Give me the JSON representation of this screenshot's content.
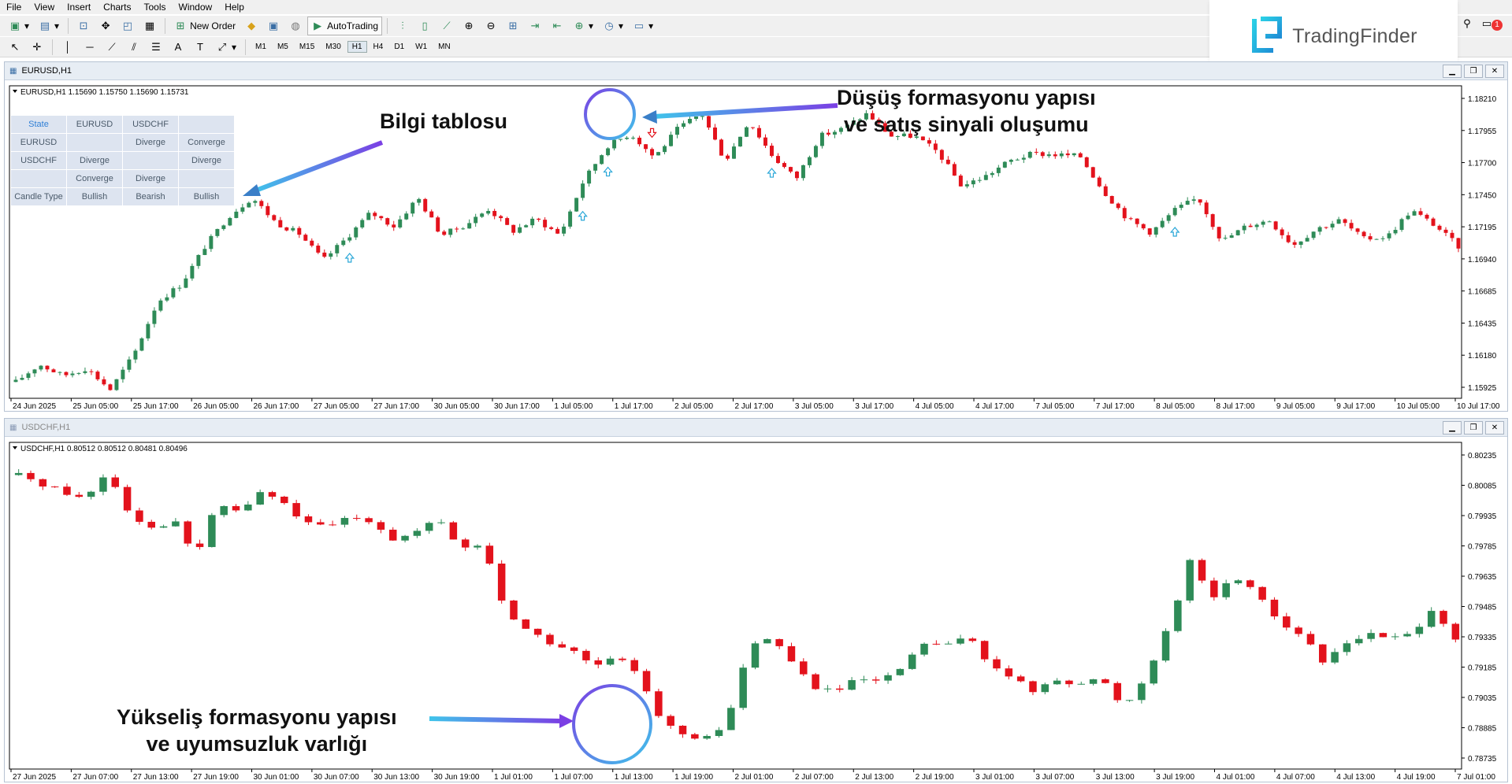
{
  "menu": [
    "File",
    "View",
    "Insert",
    "Charts",
    "Tools",
    "Window",
    "Help"
  ],
  "toolbar": {
    "new_order": "New Order",
    "autotrading": "AutoTrading"
  },
  "timeframes": [
    "M1",
    "M5",
    "M15",
    "M30",
    "H1",
    "H4",
    "D1",
    "W1",
    "MN"
  ],
  "active_timeframe": "H1",
  "brand": {
    "name": "TradingFinder"
  },
  "notifications": "1",
  "window1": {
    "title": "EURUSD,H1",
    "chart_data": {
      "type": "candlestick",
      "symbol": "EURUSD",
      "info": "EURUSD,H1  1.15690 1.15750 1.15690 1.15731",
      "y_ticks": [
        "1.18210",
        "1.17955",
        "1.17700",
        "1.17450",
        "1.17195",
        "1.16940",
        "1.16685",
        "1.16435",
        "1.16180",
        "1.15925"
      ],
      "x_ticks": [
        "24 Jun 2025",
        "25 Jun 05:00",
        "25 Jun 17:00",
        "26 Jun 05:00",
        "26 Jun 17:00",
        "27 Jun 05:00",
        "27 Jun 17:00",
        "30 Jun 05:00",
        "30 Jun 17:00",
        "1 Jul 05:00",
        "1 Jul 17:00",
        "2 Jul 05:00",
        "2 Jul 17:00",
        "3 Jul 05:00",
        "3 Jul 17:00",
        "4 Jul 05:00",
        "4 Jul 17:00",
        "7 Jul 05:00",
        "7 Jul 17:00",
        "8 Jul 05:00",
        "8 Jul 17:00",
        "9 Jul 05:00",
        "9 Jul 17:00",
        "10 Jul 05:00",
        "10 Jul 17:00"
      ],
      "ylim": [
        1.1585,
        1.1834
      ],
      "path": [
        1.1598,
        1.1612,
        1.1603,
        1.1609,
        1.1592,
        1.162,
        1.1662,
        1.1676,
        1.1706,
        1.173,
        1.1745,
        1.1725,
        1.1716,
        1.1695,
        1.1713,
        1.1733,
        1.1722,
        1.1745,
        1.1715,
        1.1723,
        1.1736,
        1.1718,
        1.1728,
        1.1715,
        1.1758,
        1.1786,
        1.1796,
        1.1777,
        1.18,
        1.1812,
        1.1774,
        1.1806,
        1.1778,
        1.176,
        1.1794,
        1.18,
        1.1812,
        1.1794,
        1.1794,
        1.1781,
        1.1754,
        1.1762,
        1.1774,
        1.178,
        1.1779,
        1.1778,
        1.175,
        1.1728,
        1.1717,
        1.1735,
        1.1745,
        1.171,
        1.1722,
        1.1727,
        1.1707,
        1.172,
        1.1727,
        1.1712,
        1.1714,
        1.1735,
        1.1723,
        1.1706
      ],
      "signals": [
        {
          "dir": "up",
          "index": 14
        },
        {
          "dir": "up",
          "index": 24
        },
        {
          "dir": "up",
          "index": 25
        },
        {
          "dir": "down",
          "index": 27
        },
        {
          "dir": "up",
          "index": 32
        },
        {
          "dir": "up",
          "index": 49
        }
      ]
    },
    "info_table": {
      "rows": [
        [
          "State",
          "EURUSD",
          "USDCHF",
          ""
        ],
        [
          "EURUSD",
          "",
          "Diverge",
          "Converge"
        ],
        [
          "USDCHF",
          "Diverge",
          "",
          "Diverge"
        ],
        [
          "",
          "Converge",
          "Diverge",
          ""
        ],
        [
          "Candle Type",
          "Bullish",
          "Bearish",
          "Bullish"
        ]
      ]
    }
  },
  "window2": {
    "title": "USDCHF,H1",
    "chart_data": {
      "type": "candlestick",
      "symbol": "USDCHF",
      "info": "USDCHF,H1  0.80512 0.80512 0.80481 0.80496",
      "y_ticks": [
        "0.80235",
        "0.80085",
        "0.79935",
        "0.79785",
        "0.79635",
        "0.79485",
        "0.79335",
        "0.79185",
        "0.79035",
        "0.78885",
        "0.78735"
      ],
      "x_ticks": [
        "27 Jun 2025",
        "27 Jun 07:00",
        "27 Jun 13:00",
        "27 Jun 19:00",
        "30 Jun 01:00",
        "30 Jun 07:00",
        "30 Jun 13:00",
        "30 Jun 19:00",
        "1 Jul 01:00",
        "1 Jul 07:00",
        "1 Jul 13:00",
        "1 Jul 19:00",
        "2 Jul 01:00",
        "2 Jul 07:00",
        "2 Jul 13:00",
        "2 Jul 19:00",
        "3 Jul 01:00",
        "3 Jul 07:00",
        "3 Jul 13:00",
        "3 Jul 19:00",
        "4 Jul 01:00",
        "4 Jul 07:00",
        "4 Jul 13:00",
        "4 Jul 19:00",
        "7 Jul 01:00"
      ],
      "ylim": [
        0.7868,
        0.8028
      ],
      "path": [
        0.8012,
        0.8008,
        0.8004,
        0.8,
        0.8014,
        0.7994,
        0.7986,
        0.799,
        0.7972,
        0.7998,
        0.7994,
        0.8004,
        0.7998,
        0.7988,
        0.7986,
        0.7992,
        0.799,
        0.798,
        0.7984,
        0.799,
        0.7976,
        0.7978,
        0.7946,
        0.7936,
        0.793,
        0.7926,
        0.7918,
        0.7922,
        0.7916,
        0.7894,
        0.7884,
        0.7882,
        0.789,
        0.7926,
        0.7934,
        0.792,
        0.7908,
        0.7906,
        0.7912,
        0.791,
        0.7918,
        0.793,
        0.7928,
        0.7934,
        0.7918,
        0.7912,
        0.7906,
        0.7912,
        0.791,
        0.7912,
        0.7898,
        0.7914,
        0.7938,
        0.797,
        0.7952,
        0.7962,
        0.7956,
        0.794,
        0.7934,
        0.792,
        0.793,
        0.7934,
        0.7932,
        0.7934,
        0.7948,
        0.793
      ]
    }
  },
  "annotations": {
    "info_table_label": "Bilgi tablosu",
    "bearish_label_1": "Düşüş formasyonu yapısı",
    "bearish_label_2": "ve satış sinyali oluşumu",
    "bullish_label_1": "Yükseliş formasyonu yapısı",
    "bullish_label_2": "ve uyumsuzluk varlığı"
  },
  "colors": {
    "bull": "#2e8b57",
    "bear": "#e3121c",
    "accent": "#2aa7d8",
    "circle_start": "#7b3fe4",
    "circle_end": "#3fb8e6"
  }
}
